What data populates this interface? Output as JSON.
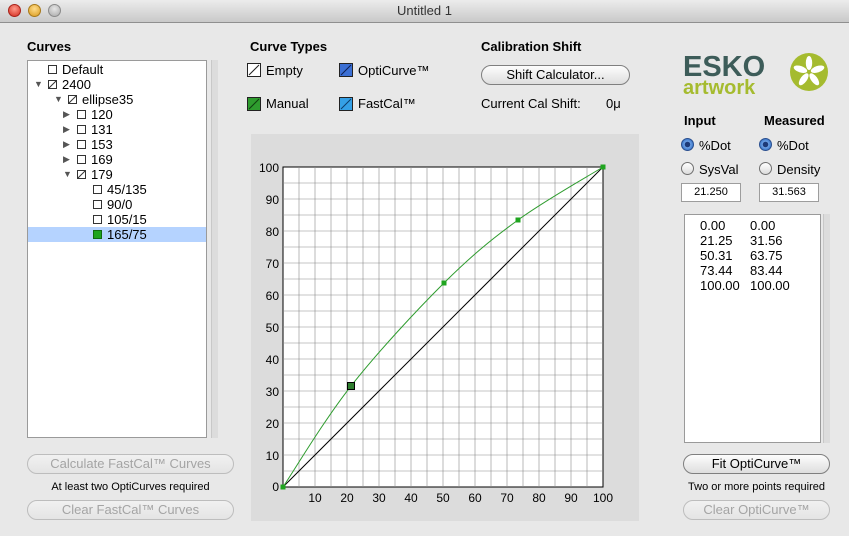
{
  "window": {
    "title": "Untitled 1"
  },
  "curves": {
    "header": "Curves",
    "tree": [
      {
        "label": "Default",
        "level": 0,
        "arrow": "",
        "check": "empty"
      },
      {
        "label": "2400",
        "level": 0,
        "arrow": "open",
        "check": "empty-slash"
      },
      {
        "label": "ellipse35",
        "level": 1,
        "arrow": "open",
        "check": "empty-slash"
      },
      {
        "label": "120",
        "level": 2,
        "arrow": "closed",
        "check": "empty"
      },
      {
        "label": "131",
        "level": 2,
        "arrow": "closed",
        "check": "empty"
      },
      {
        "label": "153",
        "level": 2,
        "arrow": "closed",
        "check": "empty"
      },
      {
        "label": "169",
        "level": 2,
        "arrow": "closed",
        "check": "empty"
      },
      {
        "label": "179",
        "level": 2,
        "arrow": "open",
        "check": "empty-slash"
      },
      {
        "label": "45/135",
        "level": 3,
        "arrow": "",
        "check": "empty"
      },
      {
        "label": "90/0",
        "level": 3,
        "arrow": "",
        "check": "empty"
      },
      {
        "label": "105/15",
        "level": 3,
        "arrow": "",
        "check": "empty"
      },
      {
        "label": "165/75",
        "level": 3,
        "arrow": "",
        "check": "green",
        "selected": true
      }
    ],
    "calc_button": "Calculate FastCal™ Curves",
    "calc_note": "At least two OptiCurves required",
    "clear_button": "Clear FastCal™ Curves"
  },
  "curve_types": {
    "header": "Curve Types",
    "items": [
      {
        "label": "Empty",
        "swatch": "empty"
      },
      {
        "label": "OptiCurve™",
        "swatch": "opti"
      },
      {
        "label": "Manual",
        "swatch": "manual"
      },
      {
        "label": "FastCal™",
        "swatch": "fastcal"
      }
    ]
  },
  "calibration": {
    "header": "Calibration Shift",
    "shift_button": "Shift Calculator...",
    "current_label": "Current Cal Shift:",
    "current_value": "0μ"
  },
  "logo": {
    "text_top": "ESKO",
    "text_bottom": "artwork"
  },
  "input": {
    "header": "Input",
    "options": [
      "%Dot",
      "SysVal"
    ],
    "selected": "%Dot",
    "value": "21.250"
  },
  "measured": {
    "header": "Measured",
    "options": [
      "%Dot",
      "Density"
    ],
    "selected": "%Dot",
    "value": "31.563"
  },
  "points_list": [
    {
      "input": "0.00",
      "measured": "0.00"
    },
    {
      "input": "21.25",
      "measured": "31.56"
    },
    {
      "input": "50.31",
      "measured": "63.75"
    },
    {
      "input": "73.44",
      "measured": "83.44"
    },
    {
      "input": "100.00",
      "measured": "100.00"
    }
  ],
  "fit_button": "Fit OptiCurve™",
  "fit_note": "Two or more points required",
  "clear_opti_button": "Clear OptiCurve™",
  "colors": {
    "curve": "#2e9c2e",
    "accent": "#3b6fd4",
    "selection": "#b5d3ff",
    "logo_dark": "#3d5c59",
    "logo_green": "#a5bb2f"
  },
  "chart_data": {
    "type": "line",
    "xlim": [
      0,
      100
    ],
    "ylim": [
      0,
      100
    ],
    "x_ticks": [
      0,
      10,
      20,
      30,
      40,
      50,
      60,
      70,
      80,
      90,
      100
    ],
    "y_ticks": [
      0,
      10,
      20,
      30,
      40,
      50,
      60,
      70,
      80,
      90,
      100
    ],
    "grid_step": 5,
    "series": [
      {
        "style": "identity",
        "color": "#000000",
        "x": [
          0,
          100
        ],
        "y": [
          0,
          100
        ]
      },
      {
        "style": "curve",
        "color": "#2e9c2e",
        "x": [
          0,
          21.25,
          50.31,
          73.44,
          100
        ],
        "y": [
          0,
          31.56,
          63.75,
          83.44,
          100
        ],
        "selected_index": 1
      }
    ]
  }
}
